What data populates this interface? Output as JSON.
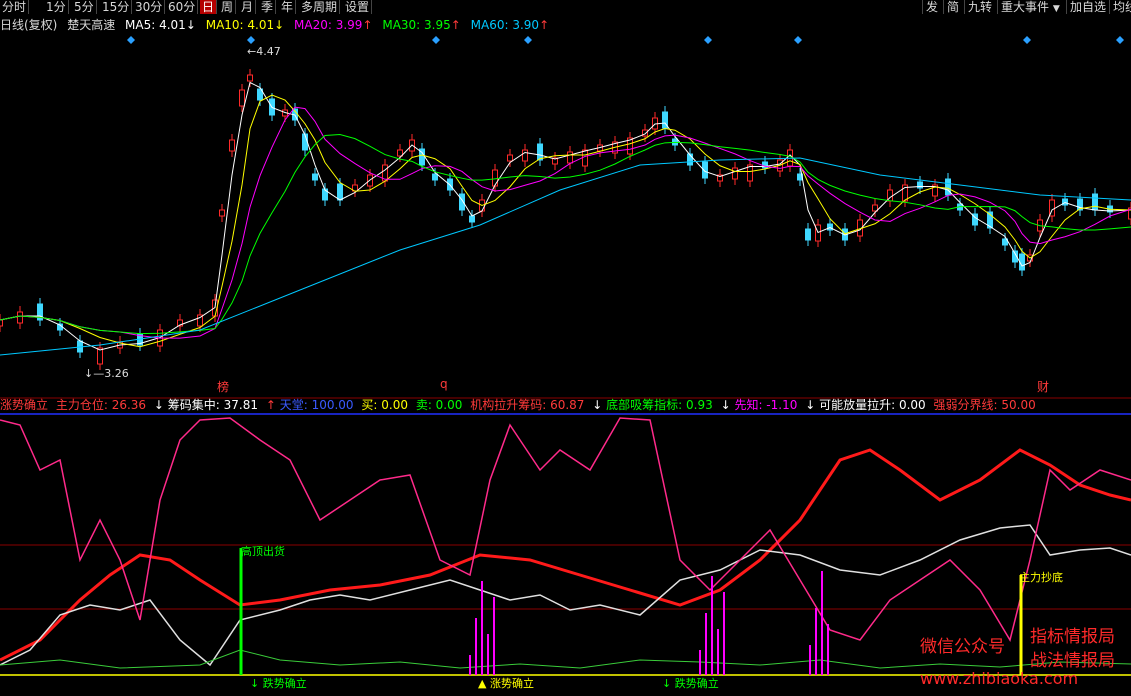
{
  "toolbar": {
    "periods": [
      "分时",
      "1分",
      "5分",
      "15分",
      "30分",
      "60分",
      "日",
      "周",
      "月",
      "季",
      "年",
      "多周期",
      "设置"
    ],
    "active": "日",
    "right": [
      "发",
      "简",
      "九转",
      "重大事件",
      "加自选",
      "均线"
    ],
    "dropdown_icon": "chevron-down-icon"
  },
  "header": {
    "title": "日线(复权)",
    "stock": "楚天高速",
    "ma": [
      {
        "label": "MA5: 4.01",
        "arrow": "↓",
        "color": "#ffffff"
      },
      {
        "label": "MA10: 4.01",
        "arrow": "↓",
        "color": "#ffff00"
      },
      {
        "label": "MA20: 3.99",
        "arrow": "↑",
        "color": "#ff00ff"
      },
      {
        "label": "MA30: 3.95",
        "arrow": "↑",
        "color": "#00ff00"
      },
      {
        "label": "MA60: 3.90",
        "arrow": "↑",
        "color": "#00c8ff"
      }
    ]
  },
  "price_labels": {
    "high": "4.47",
    "low": "3.26"
  },
  "events": [
    "榜",
    "q",
    "财"
  ],
  "indicator": {
    "items": [
      {
        "text": "涨势确立",
        "color": "#ff3a3a"
      },
      {
        "text": "主力仓位: 26.36",
        "color": "#ff3a3a"
      },
      {
        "text": "↓",
        "color": "#ffffff"
      },
      {
        "text": "筹码集中: 37.81",
        "color": "#ffffff"
      },
      {
        "text": "↑",
        "color": "#ff3a3a"
      },
      {
        "text": "天堂: 100.00",
        "color": "#3a5aff"
      },
      {
        "text": "买: 0.00",
        "color": "#ffff00"
      },
      {
        "text": "卖: 0.00",
        "color": "#00ff00"
      },
      {
        "text": "机构拉升筹码: 60.87",
        "color": "#ff3a3a"
      },
      {
        "text": "↓",
        "color": "#ffffff"
      },
      {
        "text": "底部吸筹指标: 0.93",
        "color": "#00ff00"
      },
      {
        "text": "↓",
        "color": "#ffffff"
      },
      {
        "text": "先知: -1.10",
        "color": "#ff00ff"
      },
      {
        "text": "↓",
        "color": "#ffffff"
      },
      {
        "text": "可能放量拉升: 0.00",
        "color": "#ffffff"
      },
      {
        "text": "强弱分界线: 50.00",
        "color": "#ff3a3a"
      }
    ],
    "signals": {
      "top": "高顶出货",
      "bottom": "主力抄底",
      "falls": [
        "↓ 跌势确立",
        "↓ 跌势确立"
      ],
      "rise": "涨势确立"
    }
  },
  "watermark": {
    "line1": "微信公众号",
    "line2": "指标情报局",
    "line3": "战法情报局",
    "line4": "www.zhibiaoka.com"
  }
}
